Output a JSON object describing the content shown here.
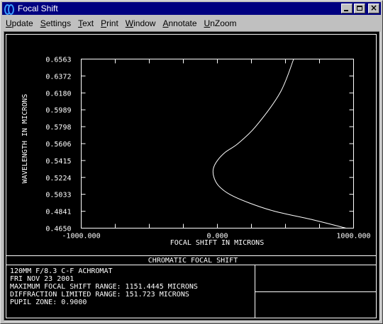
{
  "window": {
    "title": "Focal Shift",
    "controls": {
      "minimize": "minimize",
      "maximize": "maximize",
      "close": "×"
    }
  },
  "menu": [
    {
      "label": "Update",
      "underline": "U",
      "rest": "pdate"
    },
    {
      "label": "Settings",
      "underline": "S",
      "rest": "ettings"
    },
    {
      "label": "Text",
      "underline": "T",
      "rest": "ext"
    },
    {
      "label": "Print",
      "underline": "P",
      "rest": "rint"
    },
    {
      "label": "Window",
      "underline": "W",
      "rest": "indow"
    },
    {
      "label": "Annotate",
      "underline": "A",
      "rest": "nnotate"
    },
    {
      "label": "UnZoom",
      "underline": "U",
      "rest": "nZoom"
    }
  ],
  "chart_data": {
    "type": "line",
    "title": "CHROMATIC FOCAL SHIFT",
    "xlabel": "FOCAL SHIFT IN MICRONS",
    "ylabel": "WAVELENGTH IN MICRONS",
    "xlim": [
      -1000,
      1000
    ],
    "ylim": [
      0.465,
      0.6563
    ],
    "x_tick_labels": [
      "-1000.000",
      "0.000",
      "1000.000"
    ],
    "x_ticks": [
      -1000,
      0,
      1000
    ],
    "y_ticks": [
      0.465,
      0.4841,
      0.5033,
      0.5224,
      0.5415,
      0.5606,
      0.5798,
      0.5989,
      0.618,
      0.6372,
      0.6563
    ],
    "y_tick_labels": [
      "0.4650",
      "0.4841",
      "0.5033",
      "0.5224",
      "0.5415",
      "0.5606",
      "0.5798",
      "0.5989",
      "0.6180",
      "0.6372",
      "0.6563"
    ],
    "series": [
      {
        "x": [
          945,
          700,
          420,
          230,
          90,
          10,
          -25,
          -30,
          0,
          60,
          150,
          280,
          460,
          560
        ],
        "y": [
          0.465,
          0.4745,
          0.4841,
          0.4937,
          0.5033,
          0.5128,
          0.5224,
          0.532,
          0.5415,
          0.5511,
          0.5606,
          0.5798,
          0.618,
          0.6563
        ]
      }
    ],
    "color": "#ffffff",
    "background": "#000000"
  },
  "info": {
    "lines": [
      "120MM F/8.3  C-F ACHROMAT",
      "FRI NOV 23 2001",
      "MAXIMUM FOCAL SHIFT RANGE: 1151.4445 MICRONS",
      "DIFFRACTION LIMITED RANGE: 151.723 MICRONS",
      "PUPIL ZONE: 0.9000"
    ]
  }
}
